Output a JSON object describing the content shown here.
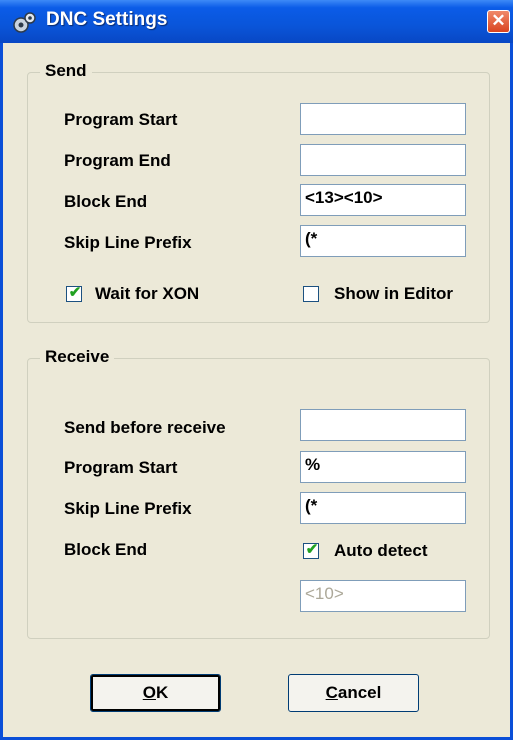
{
  "window": {
    "title": "DNC Settings",
    "close_glyph": "✕",
    "icon": "dnc-settings-icon"
  },
  "send": {
    "title": "Send",
    "program_start": {
      "label": "Program Start",
      "value": ""
    },
    "program_end": {
      "label": "Program End",
      "value": ""
    },
    "block_end": {
      "label": "Block End",
      "value": "<13><10>"
    },
    "skip_line_prefix": {
      "label": "Skip Line Prefix",
      "value": "(*"
    },
    "wait_for_xon": {
      "label": "Wait for XON",
      "checked": true
    },
    "show_in_editor": {
      "label": "Show in Editor",
      "checked": false
    }
  },
  "receive": {
    "title": "Receive",
    "send_before_receive": {
      "label": "Send before receive",
      "value": ""
    },
    "program_start": {
      "label": "Program Start",
      "value": "%"
    },
    "skip_line_prefix": {
      "label": "Skip Line Prefix",
      "value": "(*"
    },
    "block_end": {
      "label": "Block End",
      "value": "<10>"
    },
    "auto_detect": {
      "label": "Auto detect",
      "checked": true
    }
  },
  "buttons": {
    "ok": {
      "mnemonic": "O",
      "rest": "K"
    },
    "cancel": {
      "mnemonic": "C",
      "rest": "ancel"
    }
  },
  "colors": {
    "titlebar": "#0a55d9",
    "dialog": "#ece9d8",
    "check": "#21a121"
  }
}
